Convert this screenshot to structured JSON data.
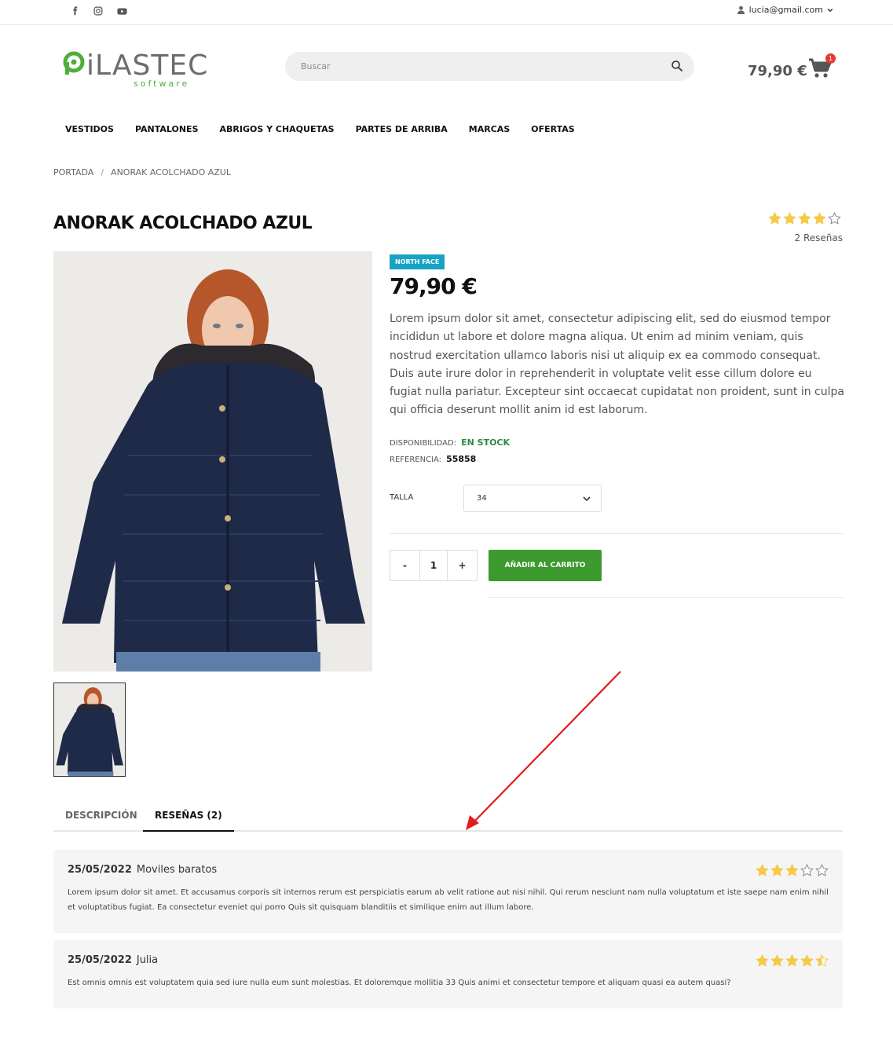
{
  "topbar": {
    "social": [
      "facebook-icon",
      "instagram-icon",
      "youtube-icon"
    ],
    "account_email": "lucia@gmail.com"
  },
  "header": {
    "logo_text": "iLASTEC",
    "logo_sub": "software",
    "search_placeholder": "Buscar",
    "cart_total": "79,90 €",
    "cart_count": "1"
  },
  "nav": {
    "items": [
      "VESTIDOS",
      "PANTALONES",
      "ABRIGOS Y CHAQUETAS",
      "PARTES DE ARRIBA",
      "MARCAS",
      "OFERTAS"
    ]
  },
  "breadcrumb": {
    "home": "PORTADA",
    "sep": "/",
    "current": "ANORAK ACOLCHADO AZUL"
  },
  "product": {
    "title": "ANORAK ACOLCHADO AZUL",
    "rating": 4,
    "rating_max": 5,
    "reviews_label": "2 Reseñas",
    "brand": "NORTH FACE",
    "price": "79,90 €",
    "description": "Lorem ipsum dolor sit amet, consectetur adipiscing elit, sed do eiusmod tempor incididun ut labore et dolore magna aliqua. Ut enim ad minim veniam, quis nostrud exercitation ullamco laboris nisi ut aliquip ex ea commodo consequat. Duis aute irure dolor in reprehenderit in voluptate velit esse cillum dolore eu fugiat nulla pariatur. Excepteur sint occaecat cupidatat non proident, sunt in culpa qui officia deserunt mollit anim id est laborum.",
    "availability_label": "DISPONIBILIDAD:",
    "availability_value": "EN STOCK",
    "reference_label": "REFERENCIA:",
    "reference_value": "55858",
    "size_label": "TALLA",
    "size_value": "34",
    "qty_minus": "-",
    "qty_value": "1",
    "qty_plus": "+",
    "add_to_cart": "AÑADIR AL CARRITO"
  },
  "tabs": {
    "description": "DESCRIPCIÓN",
    "reviews": "RESEÑAS (2)"
  },
  "reviews": [
    {
      "date": "25/05/2022",
      "author": "Moviles baratos",
      "rating": 3,
      "text": "Lorem ipsum dolor sit amet. Et accusamus corporis sit internos rerum est perspiciatis earum ab velit ratione aut nisi nihil. Qui rerum nesciunt nam nulla voluptatum et iste saepe nam enim nihil et voluptatibus fugiat. Ea consectetur eveniet qui porro Quis sit quisquam blanditiis et similique enim aut illum labore."
    },
    {
      "date": "25/05/2022",
      "author": "Julia",
      "rating": 4.5,
      "text": "Est omnis omnis est voluptatem quia sed iure nulla eum sunt molestias. Et doloremque mollitia 33 Quis animi et consectetur tempore et aliquam quasi ea autem quasi?"
    }
  ],
  "colors": {
    "accent_green": "#3c9a2e",
    "brand_badge": "#16a3c4",
    "star": "#f7c948",
    "arrow": "#e21b1b",
    "badge_red": "#e53935"
  }
}
